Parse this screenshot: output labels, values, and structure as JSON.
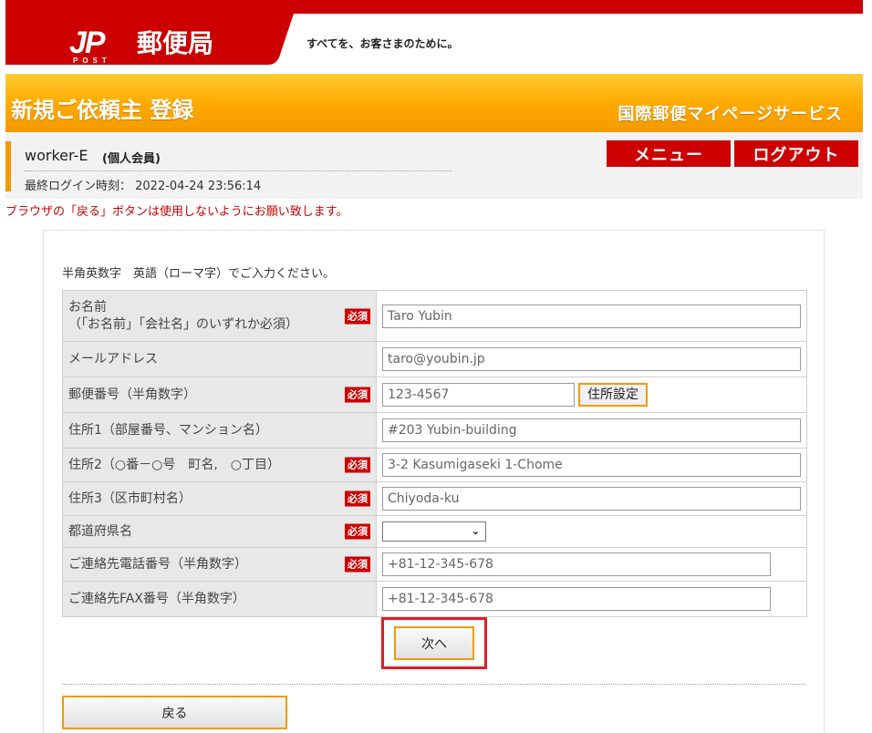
{
  "header": {
    "logo_mark": "JP",
    "logo_sub": "POST",
    "brand": "郵便局",
    "tagline": "すべてを、お客さまのために。"
  },
  "title_bar": {
    "title": "新規ご依頼主 登録",
    "service": "国際郵便マイページサービス"
  },
  "user": {
    "name": "worker-E",
    "member_type": "(個人会員)",
    "last_login": "最終ログイン時刻： 2022-04-24 23:56:14"
  },
  "nav": {
    "menu": "メニュー",
    "logout": "ログアウト"
  },
  "warning": "ブラウザの「戻る」ボタンは使用しないようにお願い致します。",
  "form": {
    "instruction": "半角英数字　英語（ローマ字）でご入力ください。",
    "required_label": "必須",
    "zip_button": "住所設定",
    "rows": [
      {
        "label_line1": "お名前",
        "label_line2": "（「お名前」「会社名」のいずれか必須）",
        "value": "Taro Yubin",
        "required": true
      },
      {
        "label_line1": "メールアドレス",
        "value": "taro@youbin.jp",
        "required": false
      },
      {
        "label_line1": "郵便番号（半角数字）",
        "value": "123-4567",
        "required": true
      },
      {
        "label_line1": "住所1（部屋番号、マンション名）",
        "value": "#203 Yubin-building",
        "required": false
      },
      {
        "label_line1": "住所2（○番－○号　町名,　○丁目）",
        "value": "3-2 Kasumigaseki 1-Chome",
        "required": true
      },
      {
        "label_line1": "住所3（区市町村名）",
        "value": "Chiyoda-ku",
        "required": true
      },
      {
        "label_line1": "都道府県名",
        "value": "",
        "required": true
      },
      {
        "label_line1": "ご連絡先電話番号（半角数字）",
        "value": "+81-12-345-678",
        "required": true
      },
      {
        "label_line1": "ご連絡先FAX番号（半角数字）",
        "value": "+81-12-345-678",
        "required": false
      }
    ]
  },
  "buttons": {
    "next": "次へ",
    "back": "戻る"
  },
  "colors": {
    "brand_red": "#cc0000",
    "orange": "#f49a00",
    "highlight": "#dd1f26"
  }
}
